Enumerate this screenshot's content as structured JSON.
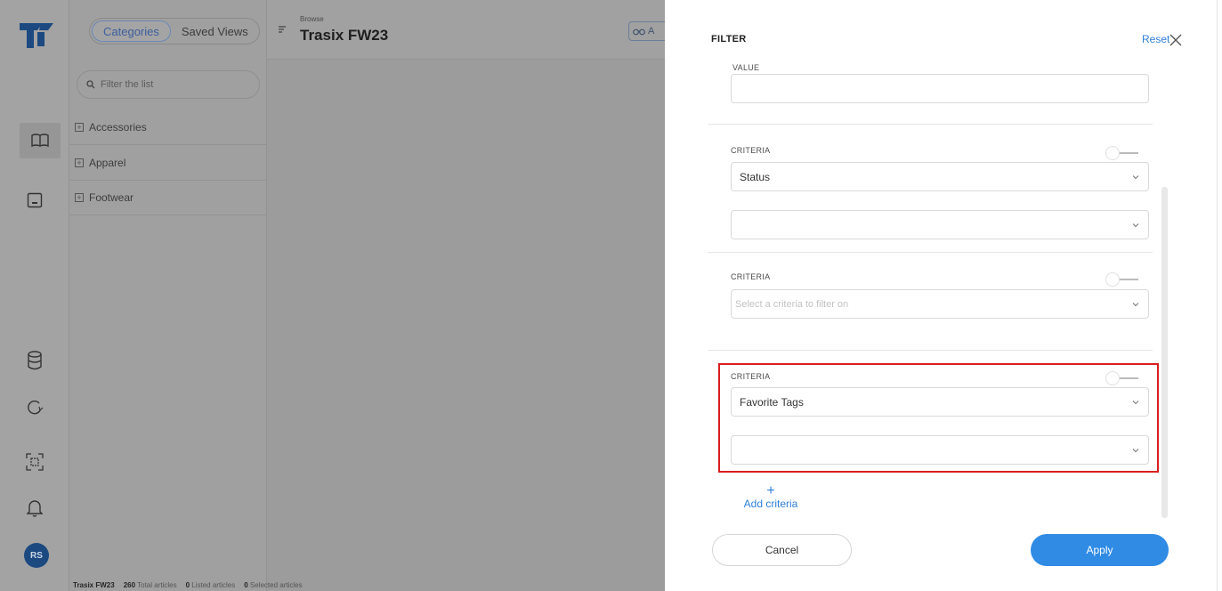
{
  "app": {
    "logo_icon": "trasix-logo-icon",
    "rail_icons": [
      "book-icon",
      "presentation-icon",
      "database-icon",
      "sync-icon",
      "scan-icon",
      "bell-icon"
    ],
    "avatar_initials": "RS",
    "accent_color": "#2f8be4"
  },
  "catpanel": {
    "tab_categories": "Categories",
    "tab_saved_views": "Saved Views",
    "filter_placeholder": "Filter the list",
    "items": [
      {
        "label": "Accessories"
      },
      {
        "label": "Apparel"
      },
      {
        "label": "Footwear"
      }
    ]
  },
  "header": {
    "breadcrumb": "Browse",
    "title": "Trasix FW23",
    "action_label": "A"
  },
  "statusbar": {
    "season": "Trasix FW23",
    "total_count": "260",
    "total_label": "Total articles",
    "listed_count": "0",
    "listed_label": "Listed articles",
    "selected_count": "0",
    "selected_label": "Selected articles"
  },
  "filter": {
    "title": "FILTER",
    "reset_label": "Reset",
    "value_label": "VALUE",
    "value_input": "",
    "criteria_label": "CRITERIA",
    "criteria": [
      {
        "selected": "Status",
        "value": ""
      },
      {
        "selected": "",
        "placeholder": "Select a criteria to filter on"
      },
      {
        "selected": "Favorite Tags",
        "value": ""
      }
    ],
    "add_criteria_label": "Add criteria",
    "add_symbol": "+",
    "cancel_label": "Cancel",
    "apply_label": "Apply"
  }
}
